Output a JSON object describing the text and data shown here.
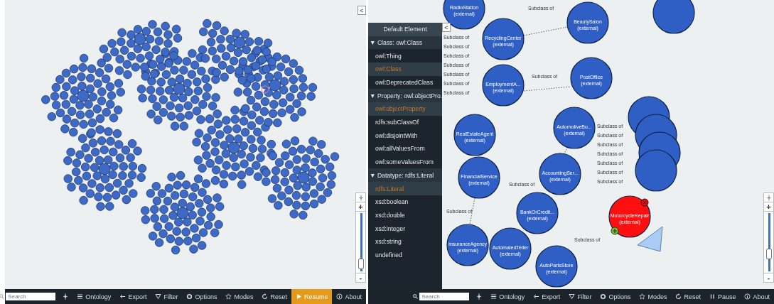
{
  "panels": [
    {
      "collapse_button": "<",
      "graph": {
        "kind": "overview"
      },
      "zoom": {
        "plus": "+",
        "minus": "-",
        "level": 0.05
      },
      "toolbar": {
        "search": {
          "placeholder": "Search"
        },
        "items": [
          {
            "kind": "ontology",
            "label": "Ontology",
            "selected": false
          },
          {
            "kind": "export",
            "label": "Export",
            "selected": false
          },
          {
            "kind": "filter",
            "label": "Filter",
            "selected": false
          },
          {
            "kind": "options",
            "label": "Options",
            "selected": false
          },
          {
            "kind": "modes",
            "label": "Modes",
            "selected": false
          },
          {
            "kind": "reset",
            "label": "Reset",
            "selected": false
          },
          {
            "kind": "resume",
            "label": "Resume",
            "selected": true
          },
          {
            "kind": "about",
            "label": "About",
            "selected": false
          }
        ]
      }
    },
    {
      "collapse_button": "<",
      "sidebar": {
        "title": "Default Element",
        "entries": [
          {
            "kind": "section",
            "label": "▼ Class: owl:Class"
          },
          {
            "kind": "item",
            "label": "owl:Thing",
            "selected": false
          },
          {
            "kind": "item",
            "label": "owl:Class",
            "selected": true
          },
          {
            "kind": "item",
            "label": "owl:DeprecatedClass",
            "selected": false
          },
          {
            "kind": "section",
            "label": "▼ Property: owl:objectPro..."
          },
          {
            "kind": "item",
            "label": "owl:objectProperty",
            "selected": true
          },
          {
            "kind": "item",
            "label": "rdfs:subClassOf",
            "selected": false
          },
          {
            "kind": "item",
            "label": "owl:disjointWith",
            "selected": false
          },
          {
            "kind": "item",
            "label": "owl:allValuesFrom",
            "selected": false
          },
          {
            "kind": "item",
            "label": "owl:someValuesFrom",
            "selected": false
          },
          {
            "kind": "section",
            "label": "▼ Datatype: rdfs:Literal"
          },
          {
            "kind": "item",
            "label": "rdfs:Literal",
            "selected": true
          },
          {
            "kind": "item",
            "label": "xsd:boolean",
            "selected": false
          },
          {
            "kind": "item",
            "label": "xsd:double",
            "selected": false
          },
          {
            "kind": "item",
            "label": "xsd:integer",
            "selected": false
          },
          {
            "kind": "item",
            "label": "xsd:string",
            "selected": false
          },
          {
            "kind": "item",
            "label": "undefined",
            "selected": false
          }
        ]
      },
      "graph": {
        "kind": "detail",
        "nodes": [
          {
            "label": "RadioStation",
            "note": "(external)",
            "selected": false
          },
          {
            "label": "RecyclingCenter",
            "note": "(external)",
            "selected": false
          },
          {
            "label": "EmploymentA...",
            "note": "(external)",
            "selected": false
          },
          {
            "label": "RealEstateAgent",
            "note": "(external)",
            "selected": false
          },
          {
            "label": "FinancialService",
            "note": "(external)",
            "selected": false
          },
          {
            "label": "BeautySalon",
            "note": "(external)",
            "selected": false
          },
          {
            "label": "PostOffice",
            "note": "(external)",
            "selected": false
          },
          {
            "label": "AutomotiveBu...",
            "note": "(external)",
            "selected": false
          },
          {
            "label": "AccountingSer...",
            "note": "(external)",
            "selected": false
          },
          {
            "label": "BankOrCredit...",
            "note": "(external)",
            "selected": false
          },
          {
            "label": "AutomatedTeller",
            "note": "(external)",
            "selected": false
          },
          {
            "label": "InsuranceAgency",
            "note": "(external)",
            "selected": false
          },
          {
            "label": "AutoPartsStore",
            "note": "(external)",
            "selected": false
          },
          {
            "label": "MotorcycleRepair",
            "note": "(external)",
            "selected": true
          }
        ],
        "edge_labels": [
          "Subclass of",
          "Subclass of",
          "Subclass of",
          "Subclass of",
          "Subclass of",
          "Subclass of",
          "Subclass of",
          "Subclass of",
          "Subclass of",
          "Subclass of",
          "Subclass of",
          "Subclass of",
          "Subclass of",
          "Subclass of",
          "Subclass of",
          "Subclass of",
          "Subclass of",
          "Subclass of",
          "Subclass of"
        ]
      },
      "zoom": {
        "plus": "+",
        "minus": "-",
        "level": 0.25
      },
      "toolbar": {
        "search": {
          "placeholder": "Search"
        },
        "items": [
          {
            "kind": "ontology",
            "label": "Ontology",
            "selected": false
          },
          {
            "kind": "export",
            "label": "Export",
            "selected": false
          },
          {
            "kind": "filter",
            "label": "Filter",
            "selected": false
          },
          {
            "kind": "options",
            "label": "Options",
            "selected": false
          },
          {
            "kind": "modes",
            "label": "Modes",
            "selected": false
          },
          {
            "kind": "reset",
            "label": "Reset",
            "selected": false
          },
          {
            "kind": "pause",
            "label": "Pause",
            "selected": false
          },
          {
            "kind": "about",
            "label": "About",
            "selected": false
          }
        ]
      }
    }
  ]
}
